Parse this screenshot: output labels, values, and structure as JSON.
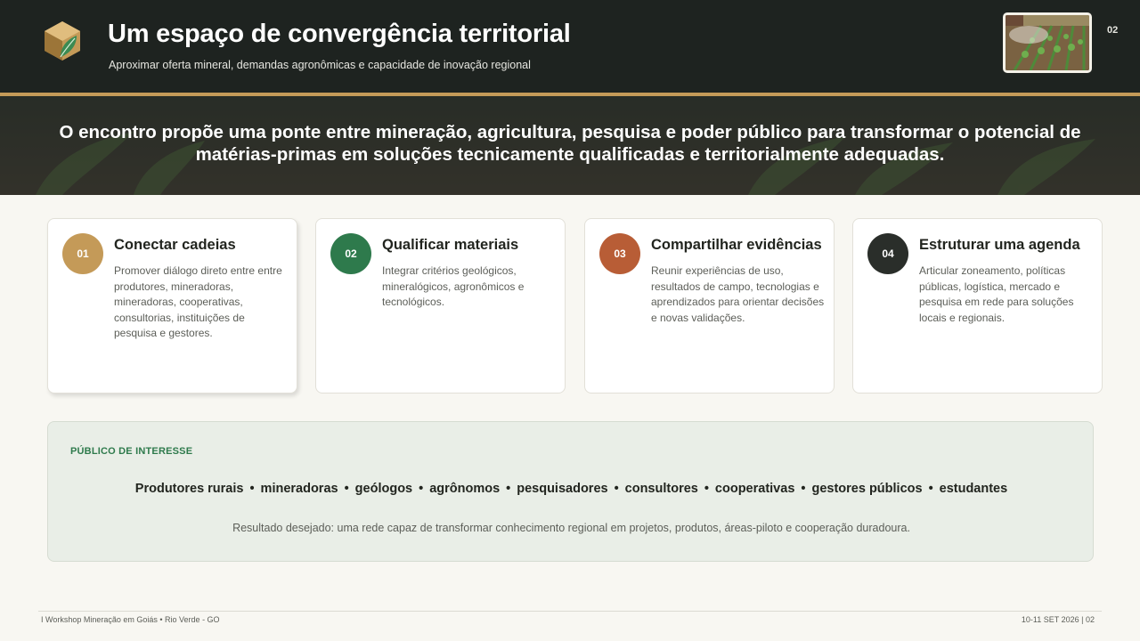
{
  "header": {
    "title": "Um espaço de convergência territorial",
    "subtitle": "Aproximar oferta mineral, demandas agronômicas e capacidade de inovação regional",
    "page_number": "02",
    "logo_icon": "hexagon-leaf-logo-icon",
    "thumbnail_icon": "crop-field-photo"
  },
  "banner": {
    "text": "O encontro propõe uma ponte entre mineração, agricultura, pesquisa e poder público para transformar o potencial de matérias-primas em soluções tecnicamente qualificadas e territorialmente adequadas."
  },
  "cards": [
    {
      "number": "01",
      "title": "Conectar cadeias",
      "text": "Promover diálogo direto entre entre produtores, mineradoras, mineradoras, cooperativas, consultorias, instituições de pesquisa e gestores.",
      "color": "#c49a58"
    },
    {
      "number": "02",
      "title": "Qualificar materiais",
      "text": "Integrar critérios geológicos, mineralógicos, agronômicos e tecnológicos.",
      "color": "#2e7a4c"
    },
    {
      "number": "03",
      "title": "Compartilhar evidências",
      "text": "Reunir experiências de uso, resultados de campo, tecnologias e aprendizados para orientar decisões e novas validações.",
      "color": "#b85d36"
    },
    {
      "number": "04",
      "title": "Estruturar uma agenda",
      "text": "Articular zoneamento, políticas públicas, logística, mercado e pesquisa em rede para soluções locais e regionais.",
      "color": "#2a2e2a"
    }
  ],
  "audience": {
    "label": "PÚBLICO DE INTERESSE",
    "items": [
      "Produtores rurais",
      "mineradoras",
      "geólogos",
      "agrônomos",
      "pesquisadores",
      "consultores",
      "cooperativas",
      "gestores públicos",
      "estudantes"
    ],
    "separator": "•",
    "result": "Resultado desejado: uma rede capaz de transformar conhecimento regional em projetos, produtos, áreas-piloto e cooperação duradoura."
  },
  "footer": {
    "left": "I Workshop Mineração em Goiás  •  Rio Verde - GO",
    "right": "10-11 SET 2026  |  02"
  },
  "colors": {
    "header_bg": "#1e2320",
    "accent_gold": "#c49a58",
    "accent_green": "#2e7a4c",
    "accent_rust": "#b85d36",
    "panel_bg": "#e9eee7"
  }
}
